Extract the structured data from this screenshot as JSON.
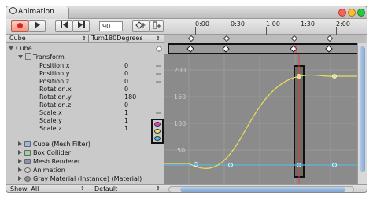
{
  "window": {
    "title": "Animation"
  },
  "toolbar": {
    "frame_value": "90",
    "record_icon": "record-icon",
    "play_icon": "play-icon",
    "prev_icon": "prev-key-icon",
    "next_icon": "next-key-icon",
    "add_key_icon": "add-keyframe-icon",
    "add_event_icon": "add-event-icon"
  },
  "ruler": {
    "ticks": [
      "0:00",
      "0:30",
      "1:00",
      "1:30",
      "2:00"
    ]
  },
  "header": {
    "object": "Cube",
    "clip": "Turn180Degrees"
  },
  "tree": {
    "root": "Cube",
    "transform": "Transform",
    "props": [
      {
        "label": "Position.x",
        "value": "0"
      },
      {
        "label": "Position.y",
        "value": "0"
      },
      {
        "label": "Position.z",
        "value": "0"
      },
      {
        "label": "Rotation.x",
        "value": "0"
      },
      {
        "label": "Rotation.y",
        "value": "180"
      },
      {
        "label": "Rotation.z",
        "value": "0"
      },
      {
        "label": "Scale.x",
        "value": "1"
      },
      {
        "label": "Scale.y",
        "value": "1"
      },
      {
        "label": "Scale.z",
        "value": "1"
      }
    ],
    "components": [
      "Cube (Mesh Filter)",
      "Box Collider",
      "Mesh Renderer",
      "Animation",
      "Gray Material (Instance) (Material)"
    ]
  },
  "graph": {
    "y_ticks": [
      "200",
      "150",
      "100",
      "50"
    ]
  },
  "colors": {
    "curve": "#e8e060",
    "flat_curve": "#5fb6d8",
    "playhead": "#e04040",
    "key_x": "#e040c0",
    "key_y": "#e8e060",
    "key_z": "#40c8e0"
  },
  "bottom": {
    "show_label": "Show: All",
    "mode_label": "Default"
  }
}
